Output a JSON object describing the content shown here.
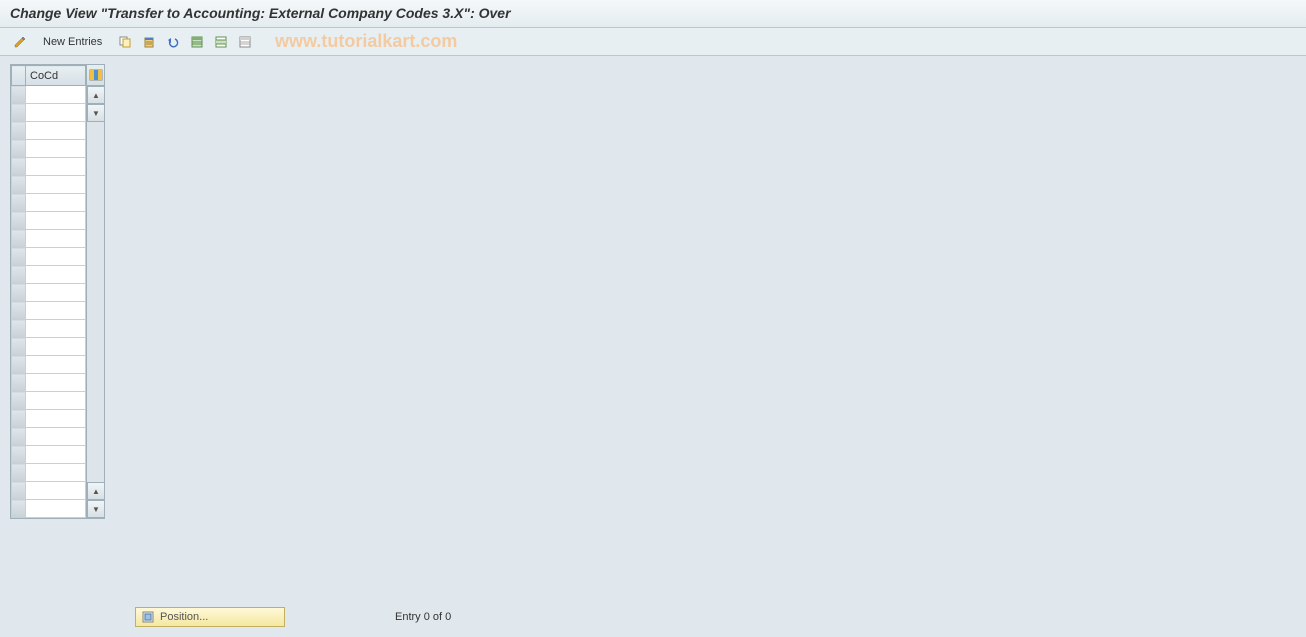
{
  "header": {
    "title": "Change View \"Transfer to Accounting: External Company Codes 3.X\": Over"
  },
  "toolbar": {
    "change_icon": "change-display-icon",
    "new_entries_label": "New Entries",
    "icons": {
      "copy": "copy-icon",
      "delete": "delete-icon",
      "undo": "undo-icon",
      "select_all": "select-all-icon",
      "select_block": "select-block-icon",
      "deselect_all": "deselect-all-icon"
    }
  },
  "watermark": "www.tutorialkart.com",
  "table": {
    "columns": {
      "cocd": "CoCd"
    },
    "rows": 24,
    "config_icon": "table-settings-icon"
  },
  "footer": {
    "position_label": "Position...",
    "entry_status": "Entry 0 of 0"
  }
}
